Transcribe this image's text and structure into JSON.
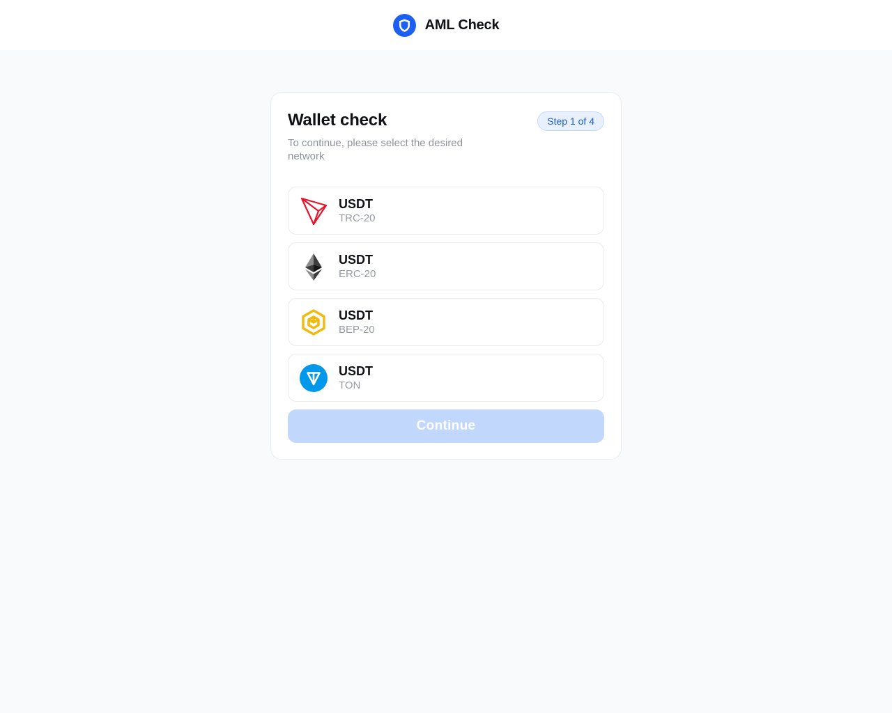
{
  "header": {
    "brand_name": "AML Check",
    "logo_icon": "shield-icon",
    "brand_color": "#1d5ff2"
  },
  "card": {
    "title": "Wallet check",
    "step_label": "Step 1 of 4",
    "subtitle": "To continue, please select the desired network",
    "networks": [
      {
        "token": "USDT",
        "standard": "TRC-20",
        "icon": "tron-icon",
        "color": "#e8132b"
      },
      {
        "token": "USDT",
        "standard": "ERC-20",
        "icon": "ethereum-icon",
        "color": "#3c3c3d"
      },
      {
        "token": "USDT",
        "standard": "BEP-20",
        "icon": "bnb-icon",
        "color": "#f0b90b"
      },
      {
        "token": "USDT",
        "standard": "TON",
        "icon": "ton-icon",
        "color": "#0098ea"
      }
    ],
    "continue_label": "Continue",
    "continue_disabled": true
  }
}
